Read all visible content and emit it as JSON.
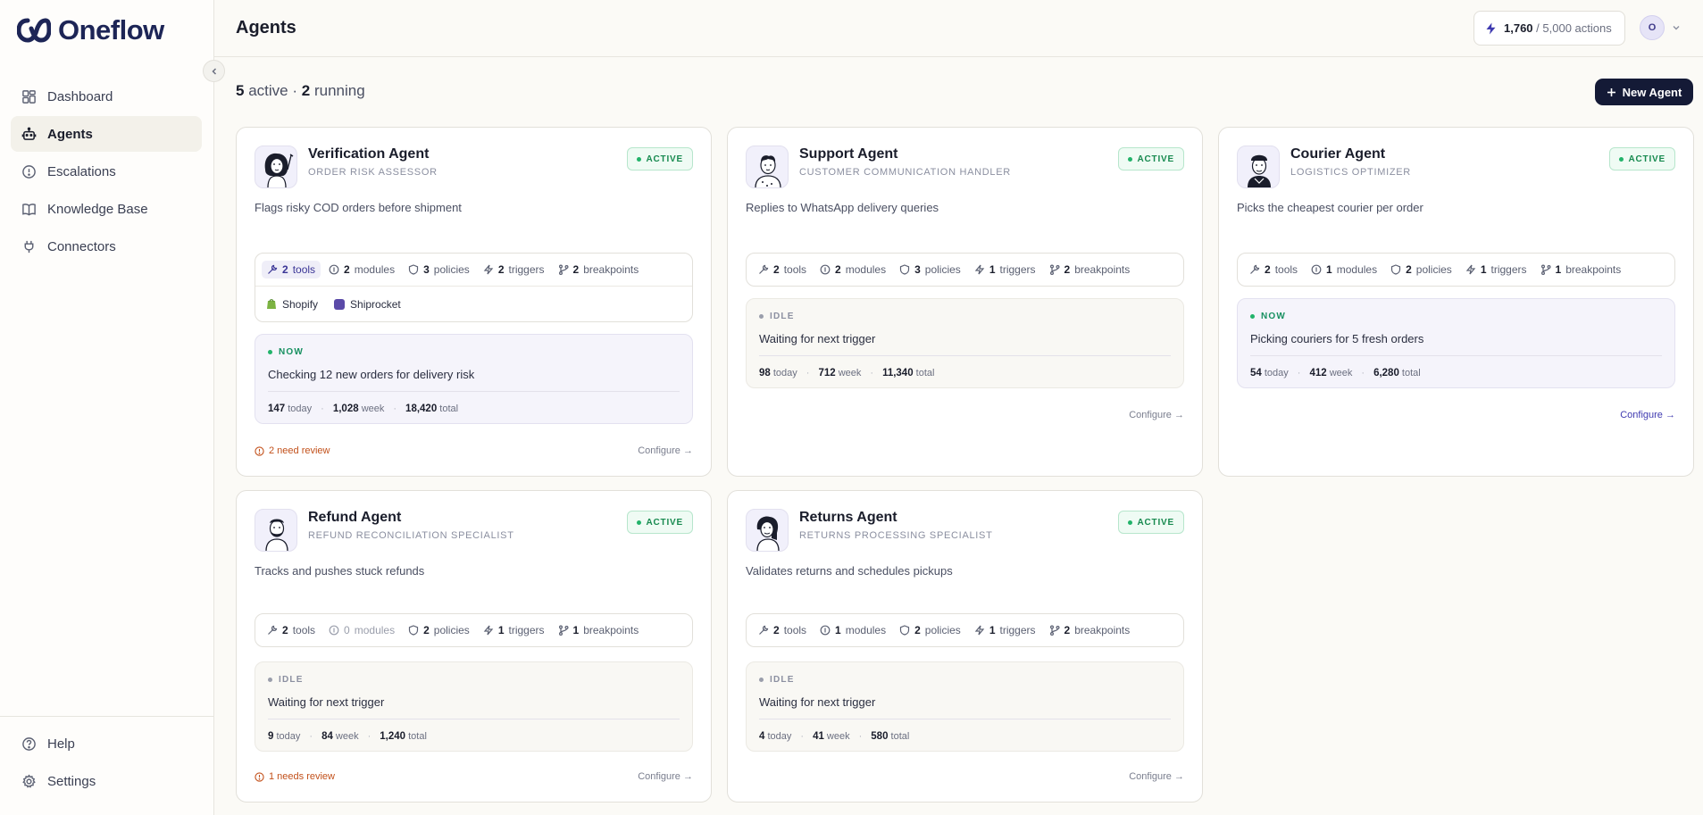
{
  "app": {
    "name": "Oneflow"
  },
  "sidebar": {
    "items": [
      {
        "label": "Dashboard",
        "icon": "dashboard-icon"
      },
      {
        "label": "Agents",
        "icon": "robot-icon",
        "active": true
      },
      {
        "label": "Escalations",
        "icon": "alert-circle-icon"
      },
      {
        "label": "Knowledge Base",
        "icon": "book-icon"
      },
      {
        "label": "Connectors",
        "icon": "plug-icon"
      }
    ],
    "bottom": [
      {
        "label": "Help",
        "icon": "help-circle-icon"
      },
      {
        "label": "Settings",
        "icon": "gear-icon"
      }
    ]
  },
  "header": {
    "title": "Agents",
    "usage_used": "1,760",
    "usage_total": "/ 5,000 actions",
    "avatar_initial": "O"
  },
  "summary": {
    "active_count": "5",
    "active_label": "active",
    "dot": "·",
    "running_count": "2",
    "running_label": "running"
  },
  "new_agent_label": "New Agent",
  "colors": {
    "brand": "#1d2556",
    "active_green": "#22b36a",
    "review_orange": "#c2501a",
    "accent": "#3f3ab0"
  },
  "agents": [
    {
      "name": "Verification Agent",
      "role": "Order Risk Assessor",
      "status": "ACTIVE",
      "description": "Flags risky COD orders before shipment",
      "stats": {
        "tools": "2",
        "tools_label": "tools",
        "modules": "2",
        "modules_label": "modules",
        "policies": "3",
        "policies_label": "policies",
        "triggers": "2",
        "triggers_label": "triggers",
        "breakpoints": "2",
        "breakpoints_label": "breakpoints"
      },
      "connectors": [
        "Shopify",
        "Shiprocket"
      ],
      "activity": {
        "state": "NOW",
        "text": "Checking 12 new orders for delivery risk",
        "today": "147",
        "week": "1,028",
        "total": "18,420"
      },
      "review": "2 need review",
      "configure": "Configure →"
    },
    {
      "name": "Support Agent",
      "role": "Customer Communication Handler",
      "status": "ACTIVE",
      "description": "Replies to WhatsApp delivery queries",
      "stats": {
        "tools": "2",
        "tools_label": "tools",
        "modules": "2",
        "modules_label": "modules",
        "policies": "3",
        "policies_label": "policies",
        "triggers": "1",
        "triggers_label": "triggers",
        "breakpoints": "2",
        "breakpoints_label": "breakpoints"
      },
      "activity": {
        "state": "IDLE",
        "text": "Waiting for next trigger",
        "today": "98",
        "week": "712",
        "total": "11,340"
      },
      "configure": "Configure →"
    },
    {
      "name": "Courier Agent",
      "role": "Logistics Optimizer",
      "status": "ACTIVE",
      "description": "Picks the cheapest courier per order",
      "stats": {
        "tools": "2",
        "tools_label": "tools",
        "modules": "1",
        "modules_label": "modules",
        "policies": "2",
        "policies_label": "policies",
        "triggers": "1",
        "triggers_label": "triggers",
        "breakpoints": "1",
        "breakpoints_label": "breakpoints"
      },
      "activity": {
        "state": "NOW",
        "text": "Picking couriers for 5 fresh orders",
        "today": "54",
        "week": "412",
        "total": "6,280"
      },
      "configure": "Configure →"
    },
    {
      "name": "Refund Agent",
      "role": "Refund Reconciliation Specialist",
      "status": "ACTIVE",
      "description": "Tracks and pushes stuck refunds",
      "stats": {
        "tools": "2",
        "tools_label": "tools",
        "modules": "0",
        "modules_label": "modules",
        "policies": "2",
        "policies_label": "policies",
        "triggers": "1",
        "triggers_label": "triggers",
        "breakpoints": "1",
        "breakpoints_label": "breakpoints"
      },
      "activity": {
        "state": "IDLE",
        "text": "Waiting for next trigger",
        "today": "9",
        "week": "84",
        "total": "1,240"
      },
      "review": "1 needs review",
      "configure": "Configure →"
    },
    {
      "name": "Returns Agent",
      "role": "Returns Processing Specialist",
      "status": "ACTIVE",
      "description": "Validates returns and schedules pickups",
      "stats": {
        "tools": "2",
        "tools_label": "tools",
        "modules": "1",
        "modules_label": "modules",
        "policies": "2",
        "policies_label": "policies",
        "triggers": "1",
        "triggers_label": "triggers",
        "breakpoints": "2",
        "breakpoints_label": "breakpoints"
      },
      "activity": {
        "state": "IDLE",
        "text": "Waiting for next trigger",
        "today": "4",
        "week": "41",
        "total": "580"
      },
      "configure": "Configure →"
    }
  ],
  "counts_labels": {
    "today": "today",
    "week": "week",
    "total": "total",
    "sep": "·"
  }
}
